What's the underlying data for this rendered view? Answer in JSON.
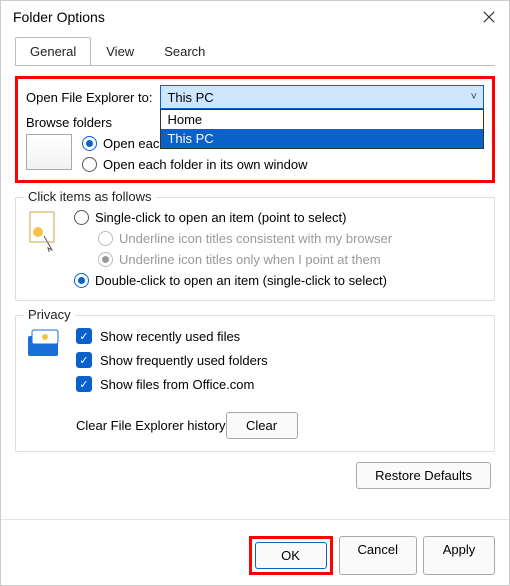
{
  "title": "Folder Options",
  "tabs": {
    "general": "General",
    "view": "View",
    "search": "Search"
  },
  "open": {
    "label": "Open File Explorer to:",
    "selected": "This PC",
    "options": [
      "Home",
      "This PC"
    ]
  },
  "browse": {
    "legend": "Browse folders",
    "same": "Open each folder in the same window",
    "own": "Open each folder in its own window"
  },
  "click": {
    "legend": "Click items as follows",
    "single": "Single-click to open an item (point to select)",
    "u_browser": "Underline icon titles consistent with my browser",
    "u_point": "Underline icon titles only when I point at them",
    "double": "Double-click to open an item (single-click to select)"
  },
  "privacy": {
    "legend": "Privacy",
    "recent": "Show recently used files",
    "freq": "Show frequently used folders",
    "office": "Show files from Office.com",
    "clear_label": "Clear File Explorer history",
    "clear_btn": "Clear"
  },
  "restore": "Restore Defaults",
  "buttons": {
    "ok": "OK",
    "cancel": "Cancel",
    "apply": "Apply"
  }
}
